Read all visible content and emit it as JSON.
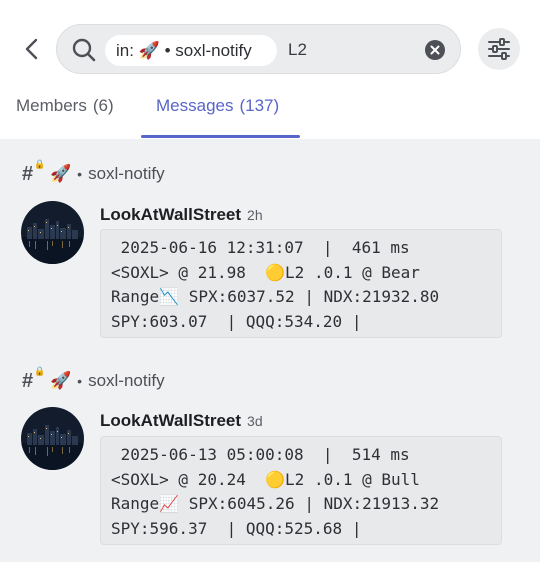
{
  "search": {
    "scope_chip": "in: 🚀 • soxl-notify",
    "query": "L2"
  },
  "tabs": [
    {
      "label": "Members",
      "count": "(6)"
    },
    {
      "label": "Messages",
      "count": "(137)"
    }
  ],
  "accent_color": "#5865c9",
  "results": [
    {
      "channel": {
        "hash": "#",
        "emoji": "🚀",
        "separator": "•",
        "name": "soxl-notify"
      },
      "author": "LookAtWallStreet",
      "time": "2h",
      "lines": [
        " 2025-06-16 12:31:07  |  461 ms",
        "<SOXL> @ 21.98  🟡L2 .0.1 @ Bear",
        "Range📉 SPX:6037.52 | NDX:21932.80",
        "SPY:603.07  | QQQ:534.20 |"
      ]
    },
    {
      "channel": {
        "hash": "#",
        "emoji": "🚀",
        "separator": "•",
        "name": "soxl-notify"
      },
      "author": "LookAtWallStreet",
      "time": "3d",
      "lines": [
        " 2025-06-13 05:00:08  |  514 ms",
        "<SOXL> @ 20.24  🟡L2 .0.1 @ Bull",
        "Range📈 SPX:6045.26 | NDX:21913.32",
        "SPY:596.37  | QQQ:525.68 |"
      ]
    }
  ]
}
